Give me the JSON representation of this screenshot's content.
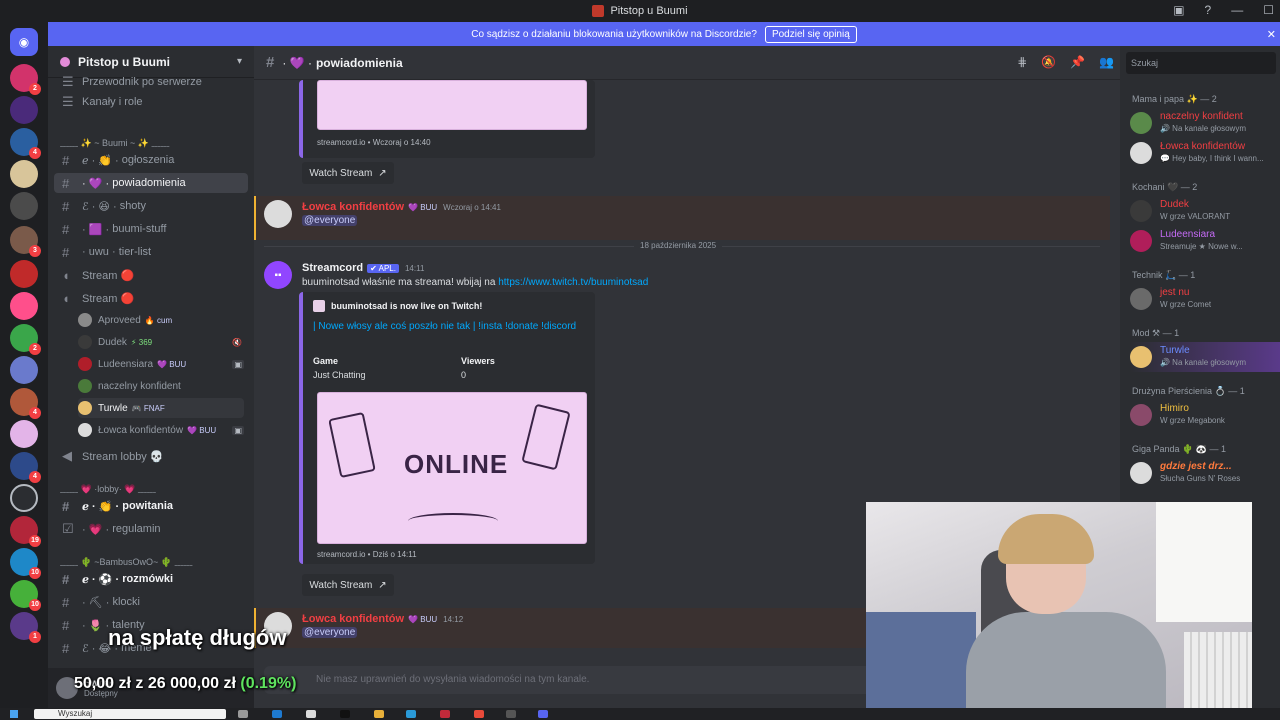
{
  "window": {
    "title": "Pitstop u Buumi"
  },
  "banner": {
    "text": "Co sądzisz o działaniu blokowania użytkowników na Discordzie?",
    "button": "Podziel się opinią"
  },
  "server": {
    "name": "Pitstop u Buumi"
  },
  "sidebar": {
    "top_items": [
      "Przewodnik po serwerze",
      "Kanały i role"
    ],
    "category1": "﹏﹏ ✨ ~ Buumi ~ ✨ ﹏﹏",
    "channels1": [
      {
        "name": "ogłoszenia",
        "prefix": "ℯ · 👏 ·"
      },
      {
        "name": "powiadomienia",
        "prefix": "· 💜 ·"
      },
      {
        "name": "shoty",
        "prefix": "ℰ · 😆 ·"
      },
      {
        "name": "buumi-stuff",
        "prefix": "· 🟪 ·"
      },
      {
        "name": "tier-list",
        "prefix": "· uwu ·"
      }
    ],
    "voice1": "Stream 🔴",
    "voice2": "Stream 🔴",
    "voice_users": [
      {
        "name": "Aproveed",
        "tag": "🔥 cum"
      },
      {
        "name": "Dudek",
        "tag": "⚡ 369"
      },
      {
        "name": "Ludeensiara",
        "tag": "💜 BUU"
      },
      {
        "name": "naczelny konfident",
        "tag": ""
      },
      {
        "name": "Turwle",
        "tag": "🎮 FNAF"
      },
      {
        "name": "Łowca konfidentów",
        "tag": "💜 BUU"
      }
    ],
    "voice3": "Stream lobby 💀",
    "category2": "﹏﹏ 💗 ·lobby· 💗 ﹏﹏",
    "channels2": [
      {
        "name": "powitania",
        "prefix": "ℯ · 👏 ·"
      },
      {
        "name": "regulamin",
        "prefix": "· 💗 ·"
      }
    ],
    "category3": "﹏﹏ 🌵 ~BambusOwO~ 🌵 ﹏﹏",
    "channels3": [
      {
        "name": "rozmówki",
        "prefix": "ℯ · ⚽ ·"
      },
      {
        "name": "klocki",
        "prefix": "· ⛏ ·"
      },
      {
        "name": "talenty",
        "prefix": "· 🌷 ·"
      },
      {
        "name": "meme",
        "prefix": "ℰ · 😂 ·"
      }
    ],
    "user": {
      "name": "Świtał",
      "status": "Dostępny"
    }
  },
  "channel_header": {
    "name": "powiadomienia",
    "prefix": "· 💜 ·"
  },
  "messages": {
    "embed1_footer": "streamcord.io • Wczoraj o 14:40",
    "watch1": "Watch Stream",
    "msg1": {
      "author": "Łowca konfidentów",
      "tag": "💜 BUU",
      "time": "Wczoraj o 14:41",
      "mention": "@everyone"
    },
    "date_divider": "18 października 2025",
    "msg2": {
      "author": "Streamcord",
      "app": "✔ APL.",
      "time": "14:11",
      "text": "buuminotsad właśnie ma streama! wbijaj na ",
      "link": "https://www.twitch.tv/buuminotsad"
    },
    "embed2": {
      "head": "buuminotsad is now live on Twitch!",
      "title": "| Nowe włosy ale coś poszło nie tak | !insta !donate !discord",
      "game_label": "Game",
      "game_value": "Just Chatting",
      "viewers_label": "Viewers",
      "viewers_value": "0",
      "image_text": "ONLINE",
      "footer": "streamcord.io • Dziś o 14:11"
    },
    "watch2": "Watch Stream",
    "msg3": {
      "author": "Łowca konfidentów",
      "tag": "💜 BUU",
      "time": "14:12",
      "mention": "@everyone"
    }
  },
  "input": {
    "placeholder": "Nie masz uprawnień do wysyłania wiadomości na tym kanale."
  },
  "members": {
    "search_placeholder": "Szukaj",
    "groups": [
      {
        "label": "Mama i papa ✨ — 2",
        "members": [
          {
            "name": "naczelny konfident",
            "status": "🔊 Na kanale głosowym",
            "color": "#f23f43"
          },
          {
            "name": "Łowca konfidentów",
            "status": "💬 Hey baby, I think I wann...",
            "color": "#f23f43"
          }
        ]
      },
      {
        "label": "Kochani 🖤 — 2",
        "members": [
          {
            "name": "Dudek",
            "status": "W grze VALORANT",
            "color": "#f23f43"
          },
          {
            "name": "Ludeensiara",
            "status": "Streamuje ★ Nowe w...",
            "color": "#c46bf5"
          }
        ]
      },
      {
        "label": "Technik 🛴 — 1",
        "members": [
          {
            "name": "jest nu",
            "status": "W grze Comet",
            "color": "#f23f43"
          }
        ]
      },
      {
        "label": "Mod ⚒ — 1",
        "members": [
          {
            "name": "Turwle",
            "status": "🔊 Na kanale głosowym",
            "color": "#6b8cff"
          }
        ]
      },
      {
        "label": "Drużyna Pierścienia 💍 — 1",
        "members": [
          {
            "name": "Himiro",
            "status": "W grze Megabonk",
            "color": "#f0c040"
          }
        ]
      },
      {
        "label": "Giga Panda 🌵 🐼 — 1",
        "members": [
          {
            "name": "gdzie jest drz...",
            "status": "Słucha Guns N' Roses",
            "color": "#ff7a3d"
          }
        ]
      }
    ]
  },
  "overlay": {
    "caption": "na spłatę długów",
    "donate_amount": "50,00 zł",
    "donate_sep": "z",
    "donate_goal": "26 000,00 zł",
    "donate_pct": "(0.19%)"
  },
  "taskbar": {
    "search": "Wyszukaj"
  }
}
